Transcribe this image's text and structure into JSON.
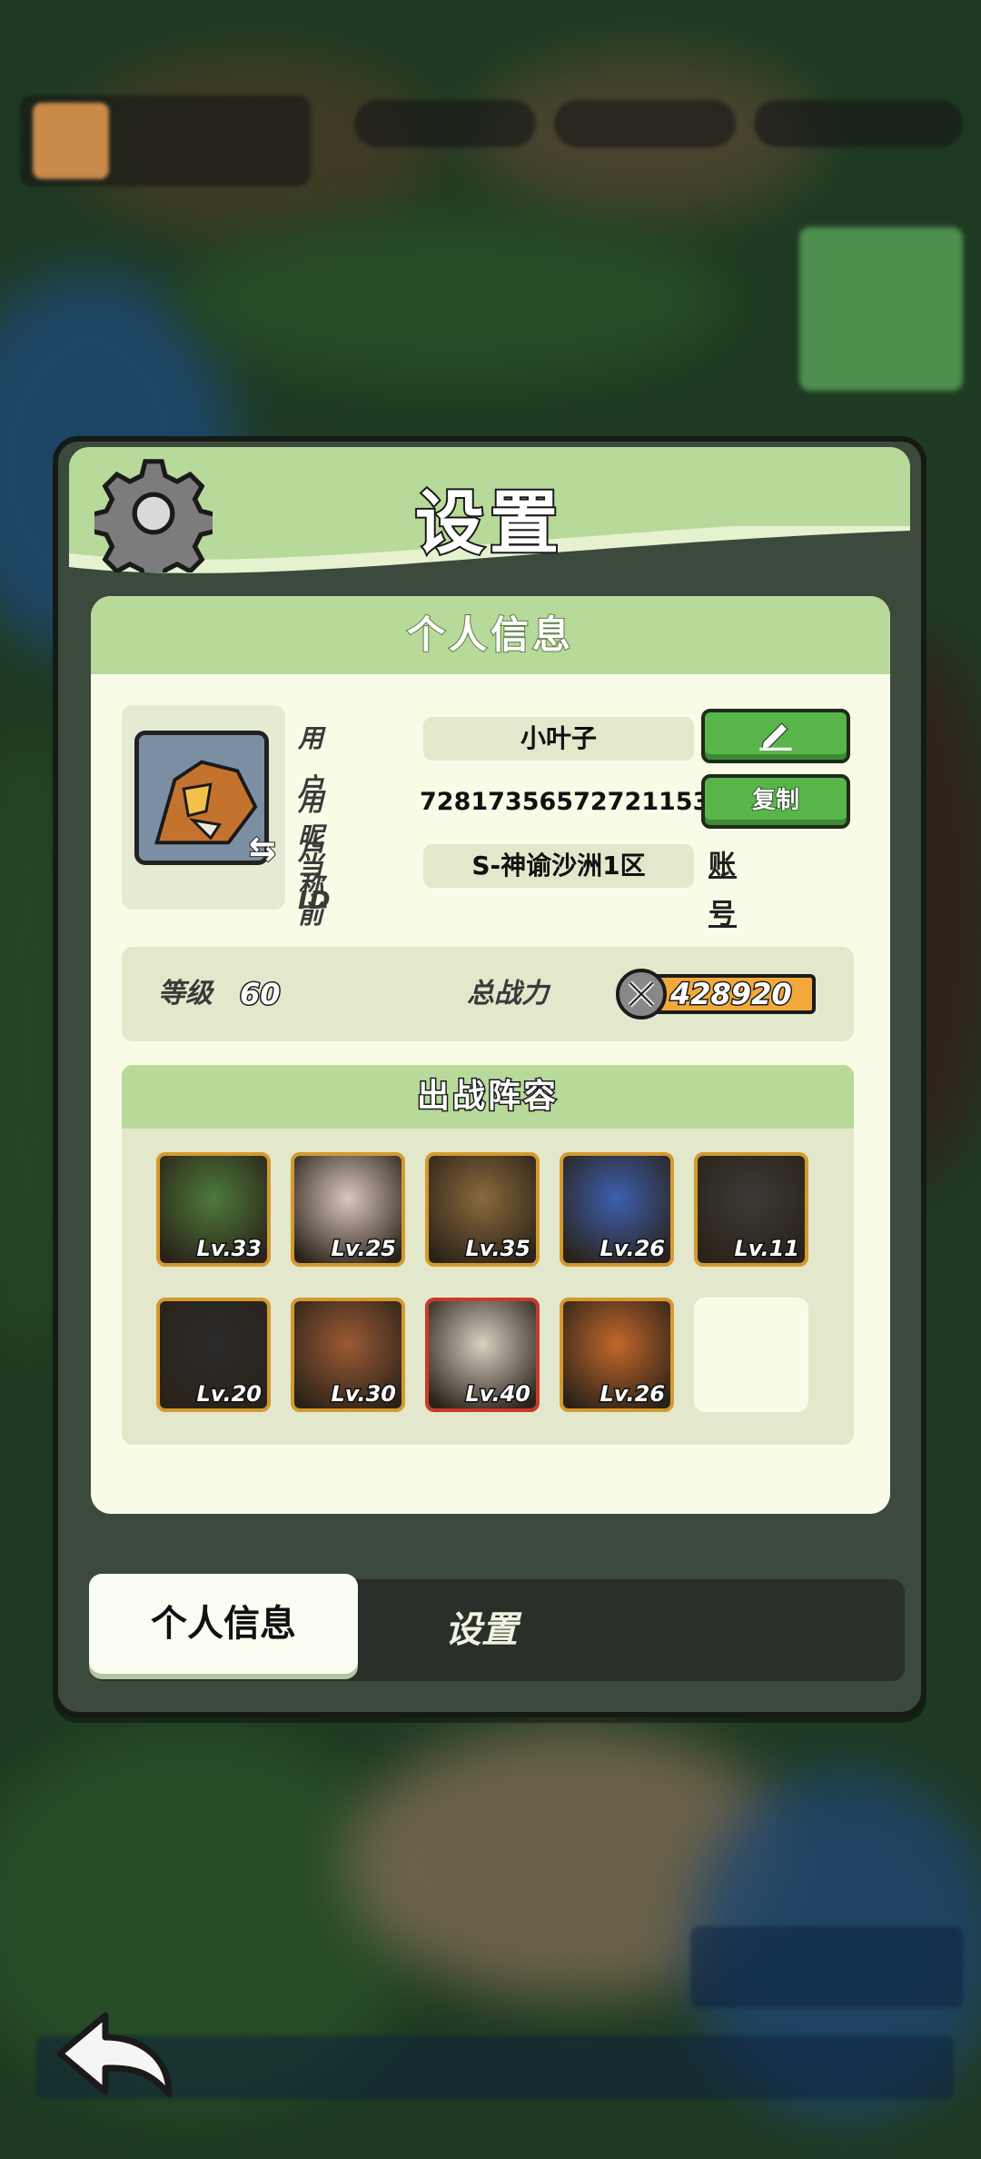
{
  "panel": {
    "title": "设置"
  },
  "profile_section": {
    "heading": "个人信息",
    "nickname_label": "用户昵称",
    "nickname_value": "小叶子",
    "id_label": "用户 ID",
    "id_value": "72817356572721153",
    "server_label": "当前区服",
    "server_value": "S-神谕沙洲1区",
    "copy_button": "复制",
    "cancel_account": "账号注销"
  },
  "stats": {
    "level_label": "等级",
    "level_value": "60",
    "power_label": "总战力",
    "power_value": "428920"
  },
  "lineup": {
    "heading": "出战阵容",
    "heroes": [
      {
        "level": "Lv.33",
        "color": "#4d7a3a"
      },
      {
        "level": "Lv.25",
        "color": "#d9c7c0"
      },
      {
        "level": "Lv.35",
        "color": "#8a6a3c"
      },
      {
        "level": "Lv.26",
        "color": "#3d5fb0"
      },
      {
        "level": "Lv.11",
        "color": "#3b3a35"
      },
      {
        "level": "Lv.20",
        "color": "#2b2b2b"
      },
      {
        "level": "Lv.30",
        "color": "#9a5a35"
      },
      {
        "level": "Lv.40",
        "color": "#d8d0c2"
      },
      {
        "level": "Lv.26",
        "color": "#c2672b"
      }
    ]
  },
  "tabs": {
    "active": "个人信息",
    "other": "设置"
  },
  "icons": {
    "settings": "gear-icon",
    "edit": "pencil-icon",
    "swap": "swap-icon",
    "back": "back-arrow-icon",
    "power": "crossed-swords-icon"
  }
}
